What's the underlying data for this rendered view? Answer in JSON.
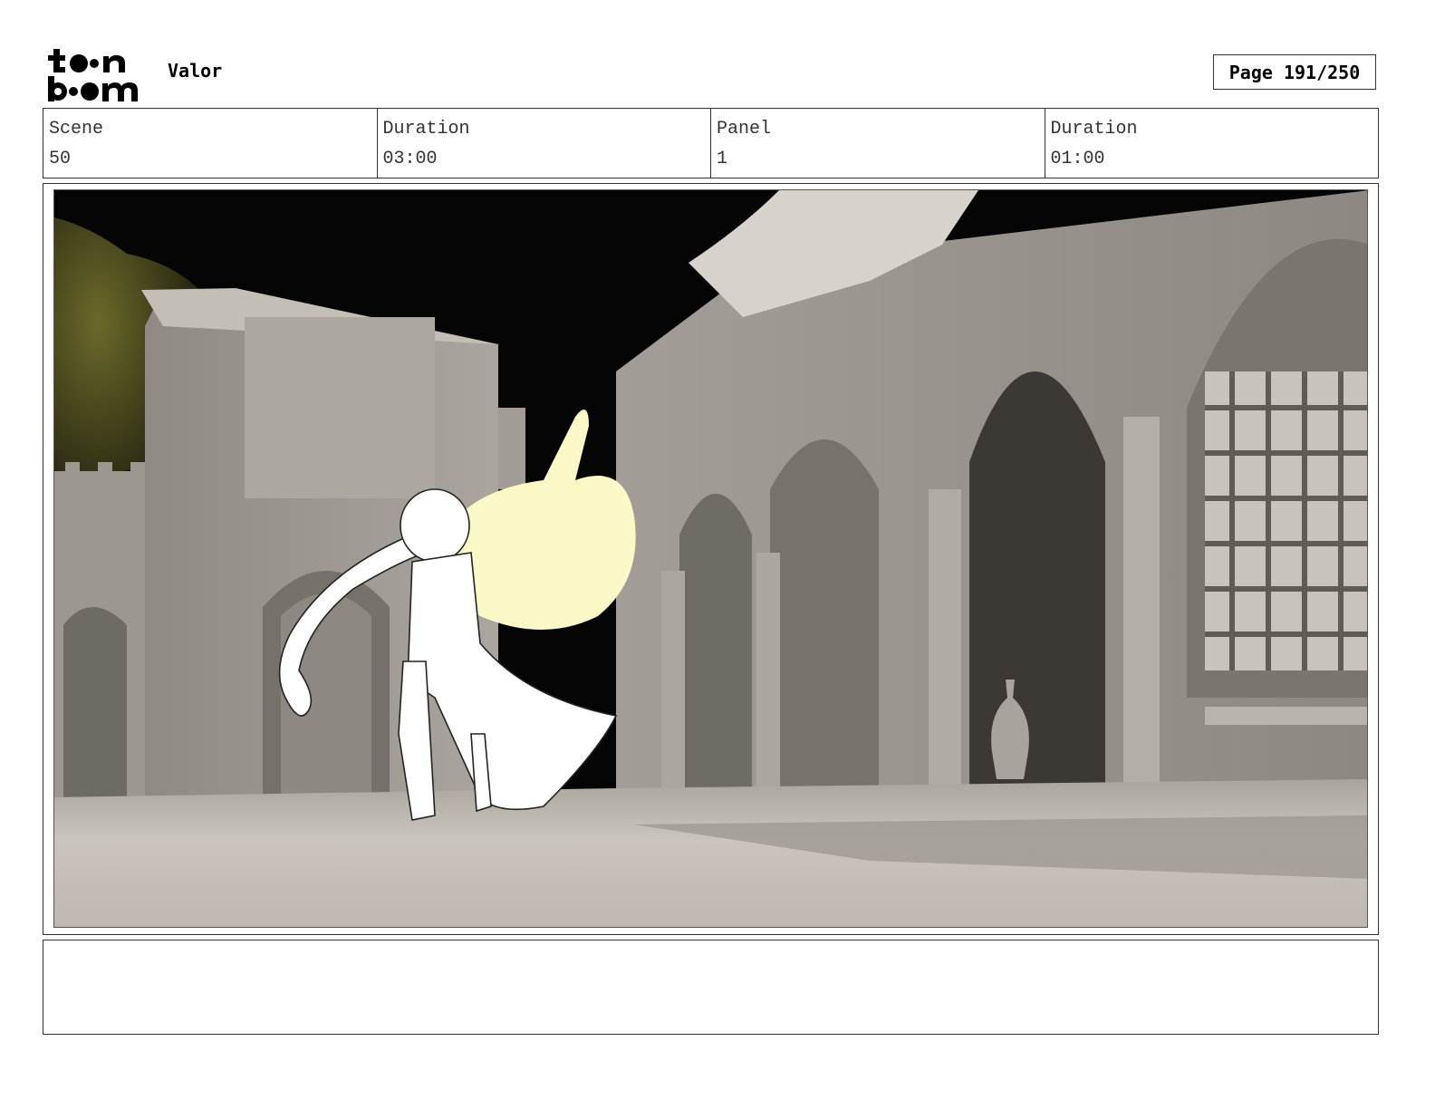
{
  "header": {
    "logo_alt": "toon boom",
    "project_title": "Valor",
    "page_label": "Page 191/250"
  },
  "info": {
    "scene_label": "Scene",
    "scene_value": "50",
    "scene_duration_label": "Duration",
    "scene_duration_value": "03:00",
    "panel_label": "Panel",
    "panel_value": "1",
    "panel_duration_label": "Duration",
    "panel_duration_value": "01:00"
  },
  "panel": {
    "notes": ""
  },
  "colors": {
    "sky": "#050505",
    "wall": "#b3aea6",
    "ground": "#c4beb6",
    "glow": "#fbf8c8"
  }
}
